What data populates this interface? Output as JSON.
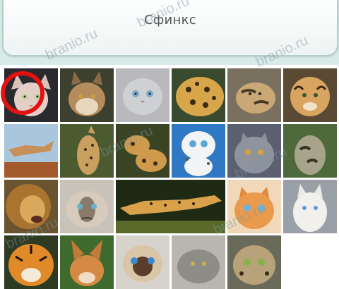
{
  "answer": {
    "text": "Сфинкс"
  },
  "watermark": {
    "text": "branio.ru"
  },
  "colors": {
    "marker": "#e11212",
    "panel": "#d9ebe8"
  },
  "tiles": [
    {
      "id": "sphynx"
    },
    {
      "id": "lynx"
    },
    {
      "id": "grey-fold-cat"
    },
    {
      "id": "jaguar"
    },
    {
      "id": "clouded-kitten"
    },
    {
      "id": "ocelot"
    },
    {
      "id": "cougar-leaping"
    },
    {
      "id": "serval"
    },
    {
      "id": "jaguar-cubs"
    },
    {
      "id": "cartoon-snow-leopard"
    },
    {
      "id": "british-shorthair"
    },
    {
      "id": "clouded-leopard"
    },
    {
      "id": "lion"
    },
    {
      "id": "grumpy-cat"
    },
    {
      "id": "cheetah-running"
    },
    {
      "id": "ginger-kitten"
    },
    {
      "id": "white-siamese"
    },
    {
      "id": "tiger"
    },
    {
      "id": "caracal"
    },
    {
      "id": "siamese-cat"
    },
    {
      "id": "pallas-cat"
    },
    {
      "id": "leopard-cat"
    }
  ]
}
